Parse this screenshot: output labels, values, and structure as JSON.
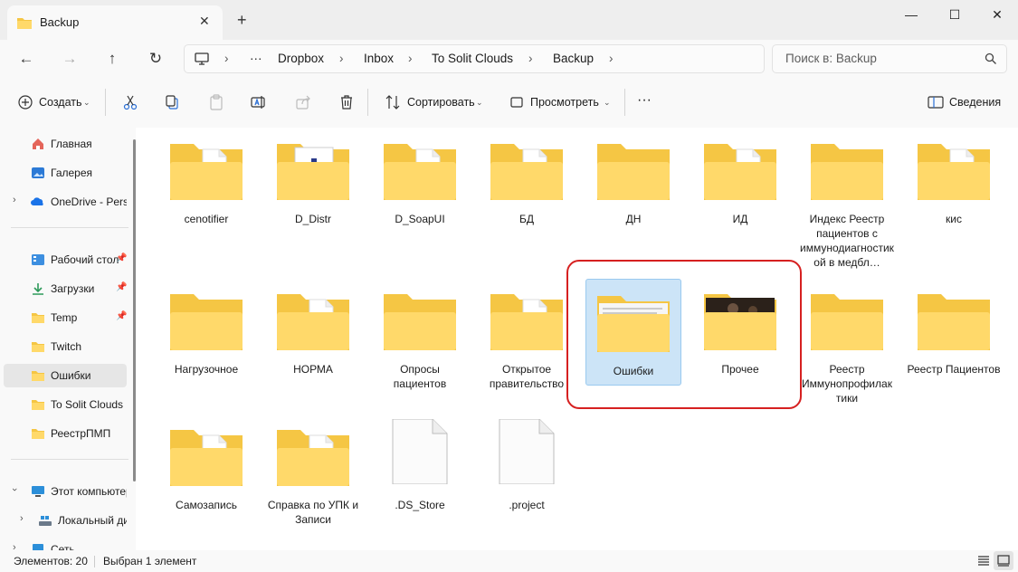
{
  "window": {
    "tab_title": "Backup",
    "new_tab": "+",
    "close_tab": "✕",
    "minimize": "—",
    "maximize": "☐",
    "close": "✕"
  },
  "address": {
    "more": "···",
    "crumbs": [
      "Dropbox",
      "Inbox",
      "To Solit Clouds",
      "Backup"
    ],
    "sep": "›"
  },
  "search": {
    "placeholder": "Поиск в: Backup"
  },
  "toolbar": {
    "create": "Создать",
    "sort": "Сортировать",
    "view": "Просмотреть",
    "more": "···",
    "details": "Сведения"
  },
  "sidebar": {
    "home": "Главная",
    "gallery": "Галерея",
    "onedrive": "OneDrive - Personal",
    "desktop": "Рабочий стол",
    "downloads": "Загрузки",
    "temp": "Temp",
    "twitch": "Twitch",
    "errors": "Ошибки",
    "solit": "To Solit Clouds",
    "registry": "РеестрПМП",
    "thispc": "Этот компьютер",
    "localdisk": "Локальный диск",
    "network": "Сеть"
  },
  "items": [
    {
      "name": "cenotifier",
      "kind": "folder-doc"
    },
    {
      "name": "D_Distr",
      "kind": "folder-img"
    },
    {
      "name": "D_SoapUI",
      "kind": "folder-doc"
    },
    {
      "name": "БД",
      "kind": "folder-doc"
    },
    {
      "name": "ДН",
      "kind": "folder"
    },
    {
      "name": "ИД",
      "kind": "folder-doc"
    },
    {
      "name": "Индекс Реестр пациентов с иммунодиагностикой в медбл…",
      "kind": "folder"
    },
    {
      "name": "кис",
      "kind": "folder-doc"
    },
    {
      "name": "Нагрузочное",
      "kind": "folder"
    },
    {
      "name": "НОРМА",
      "kind": "folder-excel"
    },
    {
      "name": "Опросы пациентов",
      "kind": "folder"
    },
    {
      "name": "Открытое правительство",
      "kind": "folder-word"
    },
    {
      "name": "Ошибки",
      "kind": "folder-text"
    },
    {
      "name": "Прочее",
      "kind": "folder-photo"
    },
    {
      "name": "Реестр Иммунопрофилактики",
      "kind": "folder"
    },
    {
      "name": "Реестр Пациентов",
      "kind": "folder"
    },
    {
      "name": "Самозапись",
      "kind": "folder-doc"
    },
    {
      "name": "Справка по УПК и Записи",
      "kind": "folder-pdf"
    },
    {
      "name": ".DS_Store",
      "kind": "file"
    },
    {
      "name": ".project",
      "kind": "file"
    }
  ],
  "status": {
    "count": "Элементов: 20",
    "selected": "Выбран 1 элемент"
  },
  "colors": {
    "folder_back": "#f5c644",
    "folder_front": "#ffd96a",
    "selection": "#cce4f7",
    "highlight": "#d62020"
  }
}
